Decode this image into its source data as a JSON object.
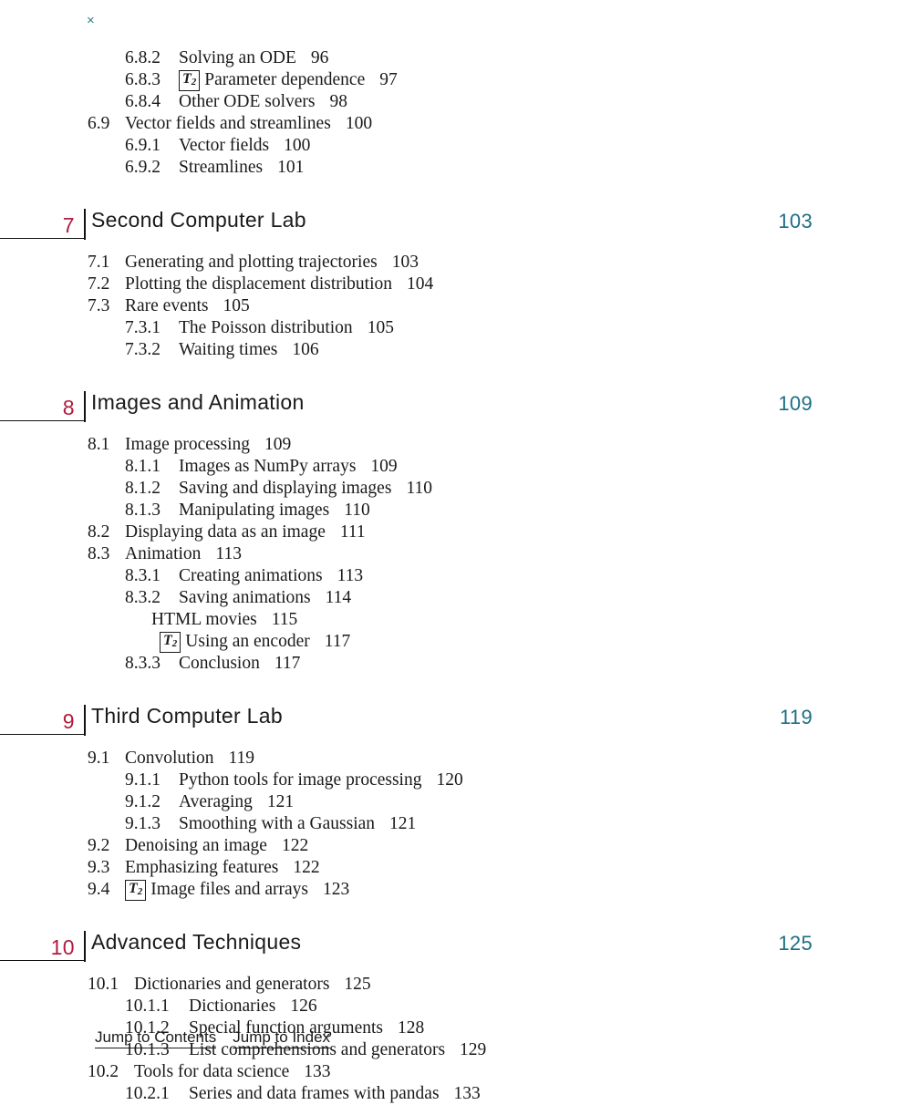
{
  "close_marker": {
    "label": "×",
    "icon": "close-x-icon",
    "color": "#2e7f8c"
  },
  "colors": {
    "chapter_number": "#b01c3e",
    "chapter_page": "#1d6e84",
    "text": "#1a1a1a",
    "rule": "#111111",
    "background": "#ffffff"
  },
  "badge": {
    "letter": "T",
    "sub": "2"
  },
  "top_entries": [
    {
      "num": "6.8.2",
      "title": "Solving an ODE",
      "page": "96",
      "level": "lvl2",
      "badge": false
    },
    {
      "num": "6.8.3",
      "title": "Parameter dependence",
      "page": "97",
      "level": "lvl2",
      "badge": true
    },
    {
      "num": "6.8.4",
      "title": "Other ODE solvers",
      "page": "98",
      "level": "lvl2",
      "badge": false
    },
    {
      "num": "6.9",
      "title": "Vector fields and streamlines",
      "page": "100",
      "level": "lvl1",
      "badge": false
    },
    {
      "num": "6.9.1",
      "title": "Vector fields",
      "page": "100",
      "level": "lvl2",
      "badge": false
    },
    {
      "num": "6.9.2",
      "title": "Streamlines",
      "page": "101",
      "level": "lvl2",
      "badge": false
    }
  ],
  "chapters": [
    {
      "number": "7",
      "title": "Second Computer Lab",
      "page": "103",
      "entries": [
        {
          "num": "7.1",
          "title": "Generating and plotting trajectories",
          "page": "103",
          "level": "lvl1",
          "badge": false
        },
        {
          "num": "7.2",
          "title": "Plotting the displacement distribution",
          "page": "104",
          "level": "lvl1",
          "badge": false
        },
        {
          "num": "7.3",
          "title": "Rare events",
          "page": "105",
          "level": "lvl1",
          "badge": false
        },
        {
          "num": "7.3.1",
          "title": "The Poisson distribution",
          "page": "105",
          "level": "lvl2",
          "badge": false
        },
        {
          "num": "7.3.2",
          "title": "Waiting times",
          "page": "106",
          "level": "lvl2",
          "badge": false
        }
      ]
    },
    {
      "number": "8",
      "title": "Images and Animation",
      "page": "109",
      "entries": [
        {
          "num": "8.1",
          "title": "Image processing",
          "page": "109",
          "level": "lvl1",
          "badge": false
        },
        {
          "num": "8.1.1",
          "title": "Images as NumPy arrays",
          "page": "109",
          "level": "lvl2",
          "badge": false
        },
        {
          "num": "8.1.2",
          "title": "Saving and displaying images",
          "page": "110",
          "level": "lvl2",
          "badge": false
        },
        {
          "num": "8.1.3",
          "title": "Manipulating images",
          "page": "110",
          "level": "lvl2",
          "badge": false
        },
        {
          "num": "8.2",
          "title": "Displaying data as an image",
          "page": "111",
          "level": "lvl1",
          "badge": false
        },
        {
          "num": "8.3",
          "title": "Animation",
          "page": "113",
          "level": "lvl1",
          "badge": false
        },
        {
          "num": "8.3.1",
          "title": "Creating animations",
          "page": "113",
          "level": "lvl2",
          "badge": false
        },
        {
          "num": "8.3.2",
          "title": "Saving animations",
          "page": "114",
          "level": "lvl2",
          "badge": false
        },
        {
          "num": "",
          "title": "HTML movies",
          "page": "115",
          "level": "lvl3",
          "badge": false
        },
        {
          "num": "",
          "title": "Using an encoder",
          "page": "117",
          "level": "lvl3b",
          "badge": true
        },
        {
          "num": "8.3.3",
          "title": "Conclusion",
          "page": "117",
          "level": "lvl2",
          "badge": false
        }
      ]
    },
    {
      "number": "9",
      "title": "Third Computer Lab",
      "page": "119",
      "entries": [
        {
          "num": "9.1",
          "title": "Convolution",
          "page": "119",
          "level": "lvl1",
          "badge": false
        },
        {
          "num": "9.1.1",
          "title": "Python tools for image processing",
          "page": "120",
          "level": "lvl2",
          "badge": false
        },
        {
          "num": "9.1.2",
          "title": "Averaging",
          "page": "121",
          "level": "lvl2",
          "badge": false
        },
        {
          "num": "9.1.3",
          "title": "Smoothing with a Gaussian",
          "page": "121",
          "level": "lvl2",
          "badge": false
        },
        {
          "num": "9.2",
          "title": "Denoising an image",
          "page": "122",
          "level": "lvl1",
          "badge": false
        },
        {
          "num": "9.3",
          "title": "Emphasizing features",
          "page": "122",
          "level": "lvl1",
          "badge": false
        },
        {
          "num": "9.4",
          "title": "Image files and arrays",
          "page": "123",
          "level": "lvl1",
          "badge": true
        }
      ]
    },
    {
      "number": "10",
      "title": "Advanced Techniques",
      "page": "125",
      "entries": [
        {
          "num": "10.1",
          "title": "Dictionaries and generators",
          "page": "125",
          "level": "lvl1w",
          "badge": false
        },
        {
          "num": "10.1.1",
          "title": "Dictionaries",
          "page": "126",
          "level": "lvl2w",
          "badge": false
        },
        {
          "num": "10.1.2",
          "title": "Special function arguments",
          "page": "128",
          "level": "lvl2w",
          "badge": false
        },
        {
          "num": "10.1.3",
          "title": "List comprehensions and generators",
          "page": "129",
          "level": "lvl2w",
          "badge": false
        },
        {
          "num": "10.2",
          "title": "Tools for data science",
          "page": "133",
          "level": "lvl1w",
          "badge": false
        },
        {
          "num": "10.2.1",
          "title": "Series and data frames with pandas",
          "page": "133",
          "level": "lvl2w",
          "badge": false
        }
      ]
    }
  ],
  "bottom_nav": [
    {
      "label": "Jump to Contents"
    },
    {
      "label": "Jump to Index"
    }
  ]
}
